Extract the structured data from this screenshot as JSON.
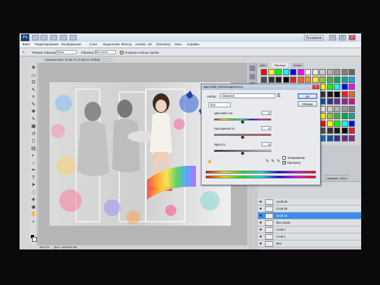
{
  "app": {
    "logo_text": "Ps",
    "workspace_label": "Основное",
    "menu": [
      "Файл",
      "Редактирование",
      "Изображение",
      "Слои",
      "Выделение",
      "Фильтр",
      "Анализ",
      "3D",
      "Просмотр",
      "Окно",
      "Справка"
    ]
  },
  "options_bar": {
    "size_label": "Размер образца:",
    "size_value": "Точка",
    "sample_label": "Образец:",
    "sample_value": "Все слои",
    "ring_label": "Показать кольцо пробы"
  },
  "document": {
    "tab_title": "Безымянный-1 @ 66,7% (Слой 34, RGB/8)",
    "status_zoom": "66,67%",
    "status_doc": "Док: 1,60M/18,6M"
  },
  "panels": {
    "tabs": [
      "Цвет",
      "Образцы",
      "Стили"
    ],
    "layers_tabs": [
      "Слои",
      "Каналы",
      "Контуры"
    ],
    "blend_mode": "Обычные",
    "opacity_label": "Непрозр.: 100%",
    "fill_label": "Заливка: 100%",
    "layers": [
      {
        "name": "Слой 36",
        "selected": false
      },
      {
        "name": "Слой 35",
        "selected": false
      },
      {
        "name": "Слой 34",
        "selected": true
      },
      {
        "name": "Фон копия",
        "selected": false
      },
      {
        "name": "Слой 2",
        "selected": false
      },
      {
        "name": "Слой 1",
        "selected": false
      },
      {
        "name": "Фон",
        "selected": false
      }
    ]
  },
  "dialog": {
    "title": "Цветовой тон/Насыщенность",
    "preset_label": "Набор:",
    "preset_value": "Заказная",
    "channel_value": "Все",
    "hue_label": "Цветовой тон:",
    "hue_value": "0",
    "saturation_label": "Насыщенность:",
    "saturation_value": "0",
    "lightness_label": "Яркость:",
    "lightness_value": "0",
    "ok_label": "ОК",
    "cancel_label": "Отмена",
    "colorize_label": "Тонирование",
    "preview_label": "Просмотр",
    "colorize_checked": false,
    "preview_checked": true
  },
  "colors": {
    "accent": "#3d8ee8",
    "chrome": "#eef1f5"
  }
}
